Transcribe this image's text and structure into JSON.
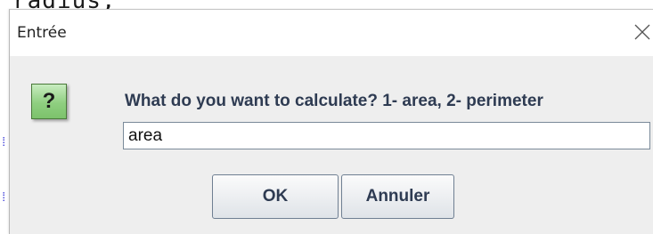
{
  "background": {
    "code_fragment": "radius;"
  },
  "dialog": {
    "title": "Entrée",
    "close_icon": "close-icon",
    "message_icon": "question-icon",
    "message_icon_glyph": "?",
    "message": "What do you want to calculate? 1- area, 2- perimeter",
    "input_value": "area",
    "ok_label": "OK",
    "cancel_label": "Annuler"
  },
  "colors": {
    "dialog_bg": "#eeeeee",
    "titlebar_bg": "#ffffff",
    "icon_green": "#8fcf80",
    "label_text": "#2e3b52"
  }
}
